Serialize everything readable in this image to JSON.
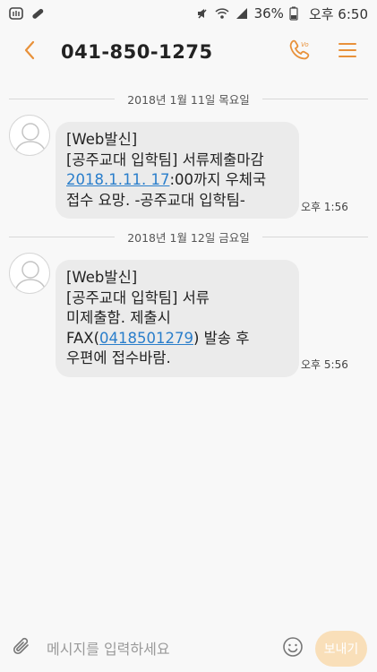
{
  "status_bar": {
    "battery_percent": "36%",
    "time": "오후 6:50",
    "icons": [
      "app-icon",
      "pill-icon",
      "mute-icon",
      "wifi-icon",
      "signal-icon",
      "battery-icon"
    ]
  },
  "header": {
    "title": "041-850-1275",
    "icons": [
      "back-arrow-icon",
      "call-icon",
      "menu-icon"
    ],
    "call_badge": "Vo"
  },
  "messages": [
    {
      "date": "2018년 1월 11일 목요일",
      "lines": [
        {
          "text": "[Web발신]"
        },
        {
          "text": "[공주교대 입학팀] 서류제출마감"
        },
        {
          "link": "2018.1.11. 17",
          "text_after": ":00까지 우체국"
        },
        {
          "text": "접수 요망. -공주교대 입학팀-"
        }
      ],
      "time": "오후 1:56"
    },
    {
      "date": "2018년 1월 12일 금요일",
      "lines": [
        {
          "text": "[Web발신]"
        },
        {
          "text": "[공주교대 입학팀] 서류"
        },
        {
          "text": "미제출함. 제출시"
        },
        {
          "text_before": "FAX(",
          "link": "0418501279",
          "text_after": ") 발송 후"
        },
        {
          "text": "우편에 접수바람."
        }
      ],
      "time": "오후 5:56"
    }
  ],
  "composer": {
    "placeholder": "메시지를 입력하세요",
    "send_label": "보내기",
    "colors": {
      "send_button": "#f9dfb9",
      "link": "#2a7ecb",
      "header_accent": "#e8913a"
    }
  }
}
